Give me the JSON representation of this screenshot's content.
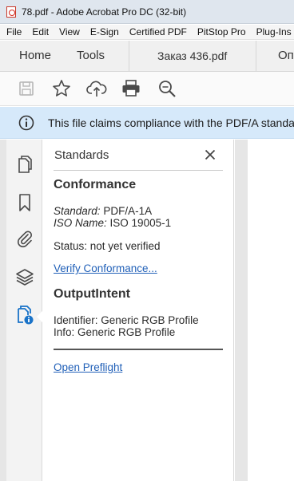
{
  "window": {
    "title": "78.pdf - Adobe Acrobat Pro DC (32-bit)",
    "app_icon": "acrobat-pdf-icon"
  },
  "menubar": {
    "items": [
      "File",
      "Edit",
      "View",
      "E-Sign",
      "Certified PDF",
      "PitStop Pro",
      "Plug-Ins"
    ]
  },
  "tabs": {
    "home": "Home",
    "tools": "Tools",
    "document": "Заказ 436.pdf",
    "extra": "Оп"
  },
  "toolbar": {
    "icons": [
      "save-icon",
      "star-icon",
      "cloud-upload-icon",
      "print-icon",
      "zoom-search-icon"
    ]
  },
  "banner": {
    "icon": "info-circle-icon",
    "text": "This file claims compliance with the PDF/A standard"
  },
  "leftnav": {
    "icons": [
      "pages-icon",
      "bookmark-icon",
      "attachment-icon",
      "layers-icon",
      "standards-icon"
    ],
    "active": "standards-icon"
  },
  "panel": {
    "title": "Standards",
    "close_icon": "close-icon",
    "conformance": {
      "heading": "Conformance",
      "standard_label": "Standard:",
      "standard_value": "PDF/A-1A",
      "iso_label": "ISO Name:",
      "iso_value": "ISO 19005-1",
      "status": "Status: not yet verified",
      "verify_link": "Verify Conformance..."
    },
    "output_intent": {
      "heading": "OutputIntent",
      "identifier": "Identifier: Generic RGB Profile",
      "info": "Info: Generic RGB Profile"
    },
    "preflight_link": "Open Preflight"
  },
  "colors": {
    "accent_link": "#2160b8",
    "banner_bg": "#d6e9fa",
    "active_nav_icon": "#1a73c8"
  }
}
